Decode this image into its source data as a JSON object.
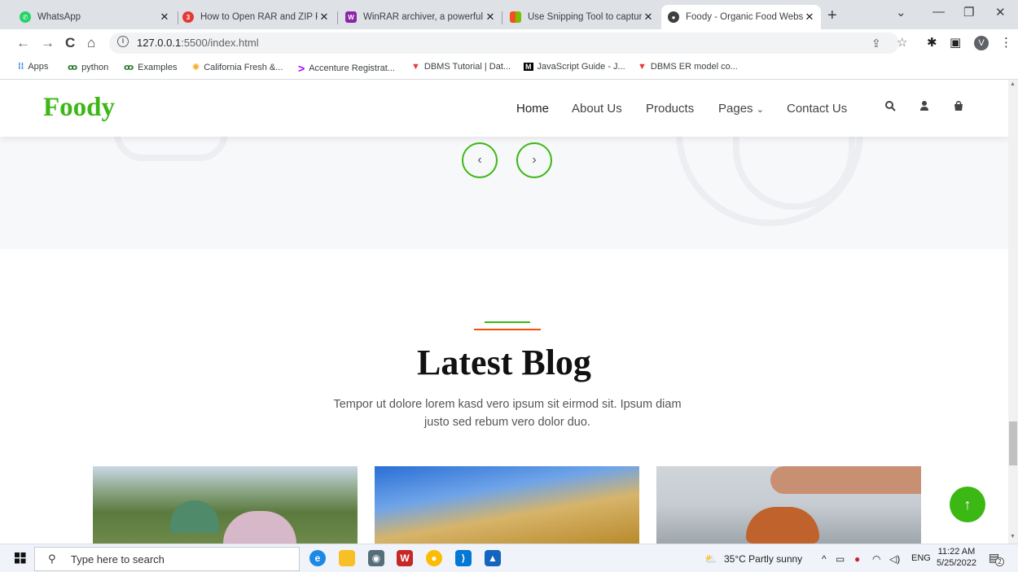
{
  "browser": {
    "tabs": [
      {
        "title": "WhatsApp",
        "icon": "whatsapp-icon"
      },
      {
        "title": "How to Open RAR and ZIP Fi",
        "icon": "360-icon"
      },
      {
        "title": "WinRAR archiver, a powerful",
        "icon": "winrar-icon"
      },
      {
        "title": "Use Snipping Tool to capture",
        "icon": "microsoft-icon"
      },
      {
        "title": "Foody - Organic Food Webs",
        "icon": "globe-icon"
      }
    ],
    "url_host": "127.0.0.1",
    "url_rest": ":5500/index.html",
    "profile_initial": "V",
    "bookmarks": [
      "Apps",
      "python",
      "Examples",
      "California Fresh &...",
      "Accenture Registrat...",
      "DBMS Tutorial | Dat...",
      "JavaScript Guide - J...",
      "DBMS ER model co..."
    ]
  },
  "site": {
    "brand": "Foody",
    "nav": [
      "Home",
      "About Us",
      "Products",
      "Pages",
      "Contact Us"
    ],
    "carousel_prev": "‹",
    "carousel_next": "›",
    "section_title": "Latest Blog",
    "section_sub": "Tempor ut dolore lorem kasd vero ipsum sit eirmod sit. Ipsum diam justo sed rebum vero dolor duo.",
    "back_to_top": "↑",
    "accent": "#3cb815",
    "accent2": "#f65005"
  },
  "taskbar": {
    "search_placeholder": "Type here to search",
    "weather": "35°C  Partly sunny",
    "lang": "ENG",
    "time": "11:22 AM",
    "date": "5/25/2022",
    "notifications": "2"
  }
}
